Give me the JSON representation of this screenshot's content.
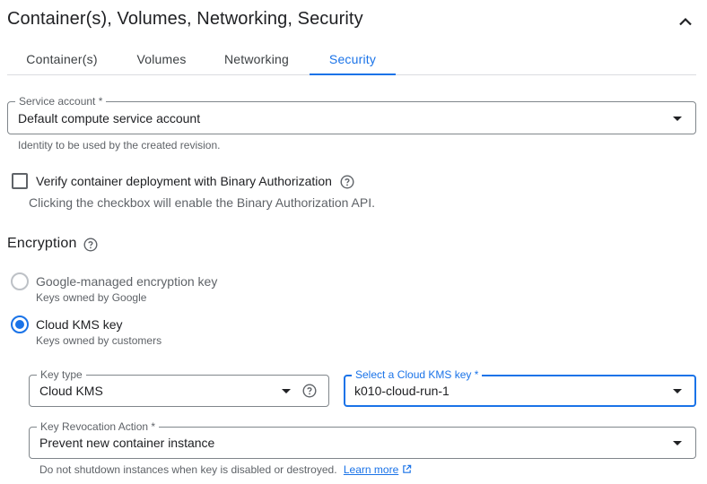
{
  "header": {
    "title": "Container(s), Volumes, Networking, Security",
    "collapse_icon": "chevron-up-icon"
  },
  "tabs": [
    {
      "label": "Container(s)",
      "active": false
    },
    {
      "label": "Volumes",
      "active": false
    },
    {
      "label": "Networking",
      "active": false
    },
    {
      "label": "Security",
      "active": true
    }
  ],
  "service_account": {
    "label": "Service account *",
    "value": "Default compute service account",
    "hint": "Identity to be used by the created revision."
  },
  "binary_authorization": {
    "label": "Verify container deployment with Binary Authorization",
    "checked": false,
    "hint": "Clicking the checkbox will enable the Binary Authorization API."
  },
  "encryption": {
    "heading": "Encryption",
    "options": [
      {
        "label": "Google-managed encryption key",
        "sublabel": "Keys owned by Google",
        "selected": false
      },
      {
        "label": "Cloud KMS key",
        "sublabel": "Keys owned by customers",
        "selected": true
      }
    ],
    "key_type": {
      "label": "Key type",
      "value": "Cloud KMS"
    },
    "kms_key": {
      "label": "Select a Cloud KMS key *",
      "value": "k010-cloud-run-1"
    },
    "revocation": {
      "label": "Key Revocation Action *",
      "value": "Prevent new container instance",
      "hint": "Do not shutdown instances when key is disabled or destroyed.",
      "link": "Learn more"
    }
  },
  "colors": {
    "accent": "#1a73e8",
    "text": "#202124",
    "muted": "#5f6368",
    "border": "#80868b"
  }
}
